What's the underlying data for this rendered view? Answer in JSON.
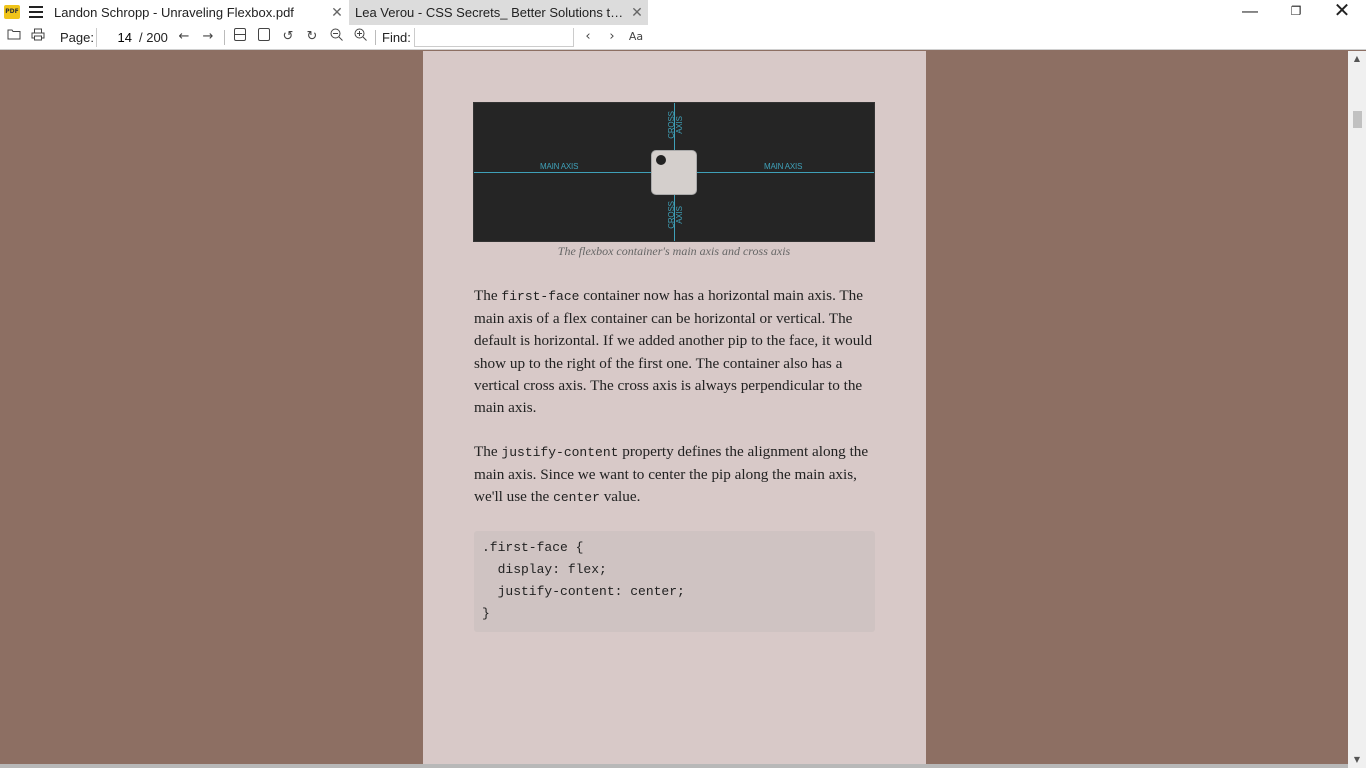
{
  "app": {
    "logo_text": "PDF"
  },
  "tabs": [
    {
      "label": "Landon Schropp - Unraveling Flexbox.pdf",
      "close": "✕"
    },
    {
      "label": "Lea Verou - CSS Secrets_ Better Solutions to Ever...",
      "close": "✕"
    }
  ],
  "window_controls": {
    "minimize": "—",
    "maximize": "❐",
    "close": "✕"
  },
  "toolbar": {
    "page_label": "Page:",
    "page_value": "14",
    "page_total": "/ 200",
    "find_label": "Find:",
    "find_value": "",
    "match_case_label": "Aa"
  },
  "figure": {
    "main_axis_left": "MAIN AXIS",
    "main_axis_right": "MAIN AXIS",
    "cross_axis_top": "CROSS AXIS",
    "cross_axis_bottom": "CROSS AXIS",
    "caption": "The flexbox container's main axis and cross axis"
  },
  "paragraph1": {
    "pre": "The ",
    "code": "first-face",
    "post": " container now has a horizontal main axis. The main axis of a flex container can be horizontal or vertical. The default is horizontal. If we added another pip to the face, it would show up to the right of the first one. The container also has a vertical cross axis. The cross axis is always perpendicular to the main axis."
  },
  "paragraph2": {
    "pre": "The ",
    "code1": "justify-content",
    "mid": " property defines the alignment along the main axis. Since we want to center the pip along the main axis, we'll use the ",
    "code2": "center",
    "post": " value."
  },
  "code_block": ".first-face {\n  display: flex;\n  justify-content: center;\n}",
  "colors": {
    "viewport_bg": "#8d6f63",
    "page_bg": "#d8c9c8",
    "axis": "#3fa0b8"
  }
}
